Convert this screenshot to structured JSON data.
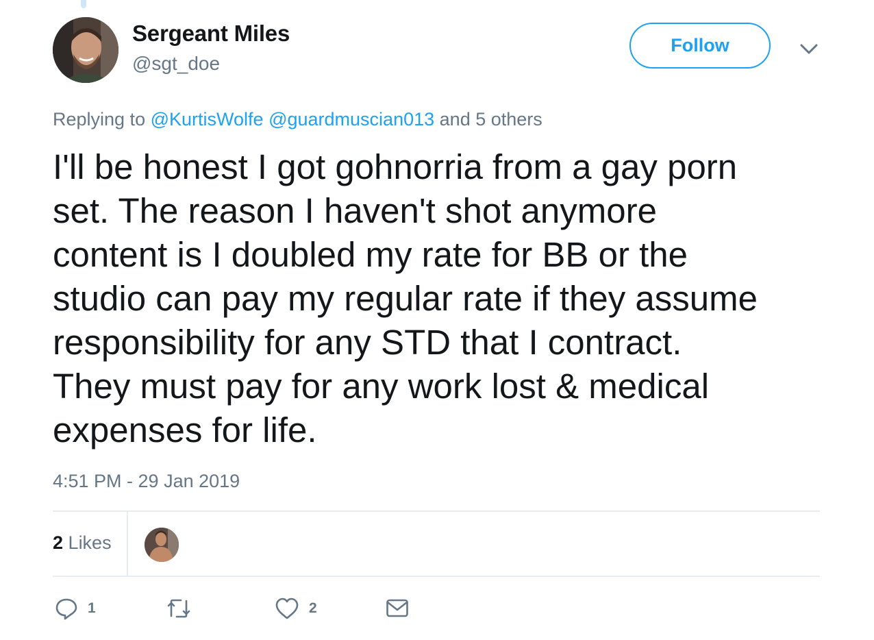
{
  "user": {
    "display_name": "Sergeant Miles",
    "handle": "@sgt_doe"
  },
  "header": {
    "follow_label": "Follow"
  },
  "reply_context": {
    "prefix": "Replying to",
    "mention_1": "@KurtisWolfe",
    "mention_2": "@guardmuscian013",
    "suffix": "and 5 others"
  },
  "tweet": {
    "lines": [
      "I'll be honest I got gohnorria from a gay porn",
      "set. The reason I haven't shot anymore",
      "content is I doubled my rate for BB or the",
      "studio can pay my regular rate if they assume",
      "responsibility for any STD that I contract.",
      "They must pay for any work lost & medical",
      "expenses for life."
    ],
    "timestamp": "4:51 PM - 29 Jan 2019"
  },
  "stats": {
    "likes_count": "2",
    "likes_label": "Likes"
  },
  "actions": {
    "reply_count": "1",
    "like_count": "2"
  },
  "colors": {
    "accent": "#1da1f2",
    "secondary_text": "#657786",
    "primary_text": "#14171a",
    "divider": "#e6ecf0"
  },
  "icons": [
    "reply-icon",
    "retweet-icon",
    "heart-icon",
    "envelope-icon",
    "chevron-down-icon"
  ]
}
